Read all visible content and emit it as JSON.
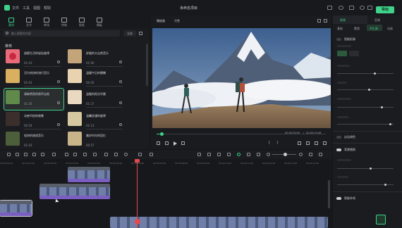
{
  "app": {
    "menus": [
      "文件",
      "工具",
      "视图",
      "帮助"
    ],
    "project_title": "未命名项目",
    "export_label": "导出"
  },
  "tools": [
    {
      "label": "素材",
      "icon": "music-note-icon",
      "active": true
    },
    {
      "label": "文字",
      "icon": "text-icon",
      "active": false
    },
    {
      "label": "转场",
      "icon": "transition-icon",
      "active": false
    },
    {
      "label": "特效",
      "icon": "effects-icon",
      "active": false
    },
    {
      "label": "贴纸",
      "icon": "sticker-icon",
      "active": false
    },
    {
      "label": "模板",
      "icon": "template-icon",
      "active": false
    }
  ],
  "media": {
    "search_placeholder": "输入搜索的内容",
    "filter_label": "全部",
    "section_label": "推荐",
    "items": [
      {
        "title": "甜蜜生活的轻松旋律",
        "duration": "01:43",
        "thumb": "#e86b7a",
        "selected": false
      },
      {
        "title": "舒缓的大自然音乐",
        "duration": "01:00",
        "thumb": "#c4a57a",
        "selected": false
      },
      {
        "title": "活力欢快的流行音乐",
        "duration": "01:03",
        "thumb": "#d8b060",
        "selected": false
      },
      {
        "title": "温暖午后的慵懒",
        "duration": "00:45",
        "thumb": "#e9d2b0",
        "selected": false
      },
      {
        "title": "清新明亮的原声吉他",
        "duration": "01:26",
        "thumb": "#5f8a4a",
        "selected": true
      },
      {
        "title": "温暖的阳光早晨",
        "duration": "01:27",
        "thumb": "#e8d9c0",
        "selected": false
      },
      {
        "title": "动感节拍的夜晚",
        "duration": "00:54",
        "thumb": "#3a2f2a",
        "selected": false
      },
      {
        "title": "温馨浪漫的旋律",
        "duration": "01:13",
        "thumb": "#d6c8a0",
        "selected": false
      },
      {
        "title": "轻快的旅途音乐",
        "duration": "01:03",
        "thumb": "#4c5f3a",
        "selected": false
      },
      {
        "title": "美好时光的回忆",
        "duration": "00:57",
        "thumb": "#c9b48a",
        "selected": false
      }
    ]
  },
  "player": {
    "mode_label": "播放器",
    "quality_label": "完整",
    "current_time": "00:00:00:05",
    "total_time": "00:00:19:08"
  },
  "inspector": {
    "tabs": [
      {
        "label": "视频",
        "active": true
      },
      {
        "label": "音频",
        "active": false
      }
    ],
    "subtabs": [
      {
        "label": "基础",
        "active": false
      },
      {
        "label": "蒙版",
        "active": false
      },
      {
        "label": "AI工具",
        "active": true
      },
      {
        "label": "动画",
        "active": false
      }
    ],
    "section1_label": "智能抠像",
    "section2_label": "自动调色",
    "section3_label": "背景替换",
    "section4_label": "智能补帧"
  },
  "timeline": {
    "ticks": [
      "00:00:00:00",
      "00:00:01:00",
      "00:00:02:00",
      "00:00:03:00",
      "00:00:04:00",
      "00:00:05:00",
      "00:00:06:00",
      "00:00:07:00",
      "00:00:08:00",
      "00:00:09:00",
      "00:00:10:00",
      "00:00:11:00",
      "00:00:12:00",
      "00:00:13:00",
      "00:00:14:00"
    ]
  }
}
